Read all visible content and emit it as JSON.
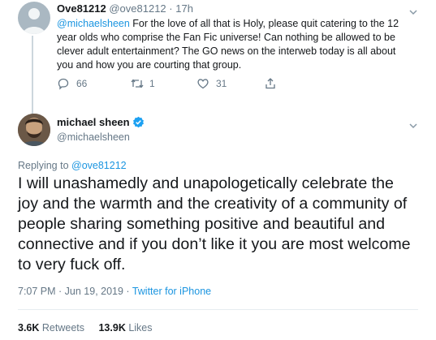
{
  "reply_tweet": {
    "display_name": "Ove81212",
    "handle": "@ove81212",
    "separator": "·",
    "time": "17h",
    "text_mention": "@michaelsheen",
    "text_body": " For the love of all that is Holy, please quit catering to the 12 year olds who comprise the Fan Fic universe!  Can nothing be allowed to be clever adult entertainment?  The GO news on the interweb today is all about you and how you are courting that group.",
    "replies": "66",
    "retweets": "1",
    "likes": "31",
    "icons": [
      "chevron-down-icon",
      "reply-icon",
      "retweet-icon",
      "like-icon",
      "share-icon"
    ]
  },
  "main_tweet": {
    "display_name": "michael sheen",
    "handle": "@michaelsheen",
    "replying_prefix": "Replying to ",
    "replying_to": "@ove81212",
    "text": "I will unashamedly and unapologetically celebrate the joy and the warmth and the creativity of a community of people sharing something positive and beautiful and connective and if you don’t like it you are most welcome to very fuck off.",
    "timestamp": "7:07 PM · Jun 19, 2019 · ",
    "source": "Twitter for iPhone",
    "retweets_count": "3.6K",
    "retweets_label": "Retweets",
    "likes_count": "13.9K",
    "likes_label": "Likes",
    "icons": [
      "verified-badge-icon",
      "chevron-down-icon"
    ],
    "colors": {
      "accent": "#1da1f2",
      "link": "#1b95e0",
      "muted": "#657786"
    }
  }
}
